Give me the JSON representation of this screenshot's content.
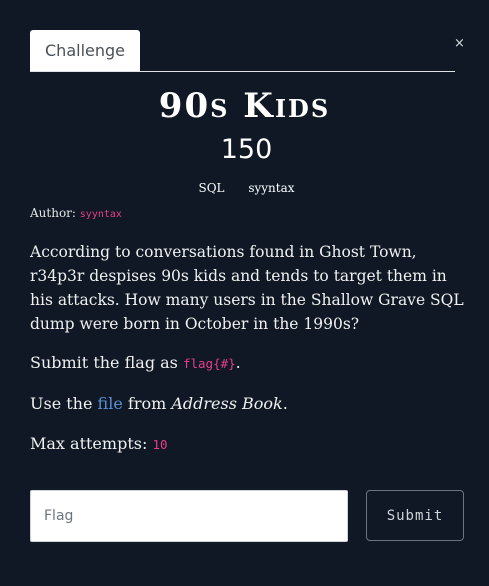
{
  "modal": {
    "close_label": "×"
  },
  "tabs": [
    {
      "label": "Challenge",
      "active": true
    }
  ],
  "challenge": {
    "title": "90s Kids",
    "points": "150",
    "tags": [
      "SQL",
      "syyntax"
    ],
    "author_label": "Author:",
    "author": "syyntax",
    "description": "According to conversations found in Ghost Town, r34p3r despises 90s kids and tends to target them in his attacks. How many users in the Shallow Grave SQL dump were born in October in the 1990s?",
    "submit_prefix": "Submit the flag as ",
    "flag_format": "flag{#}",
    "submit_suffix": ".",
    "use_prefix": "Use the ",
    "file_link": "file",
    "use_middle": " from ",
    "source_name": "Address Book",
    "use_suffix": ".",
    "max_attempts_label": "Max attempts: ",
    "max_attempts": "10"
  },
  "form": {
    "flag_placeholder": "Flag",
    "flag_value": "",
    "submit_label": "Submit"
  },
  "colors": {
    "background": "#0f1824",
    "code_pink": "#e83e8c",
    "link_blue": "#5b8fd6"
  }
}
